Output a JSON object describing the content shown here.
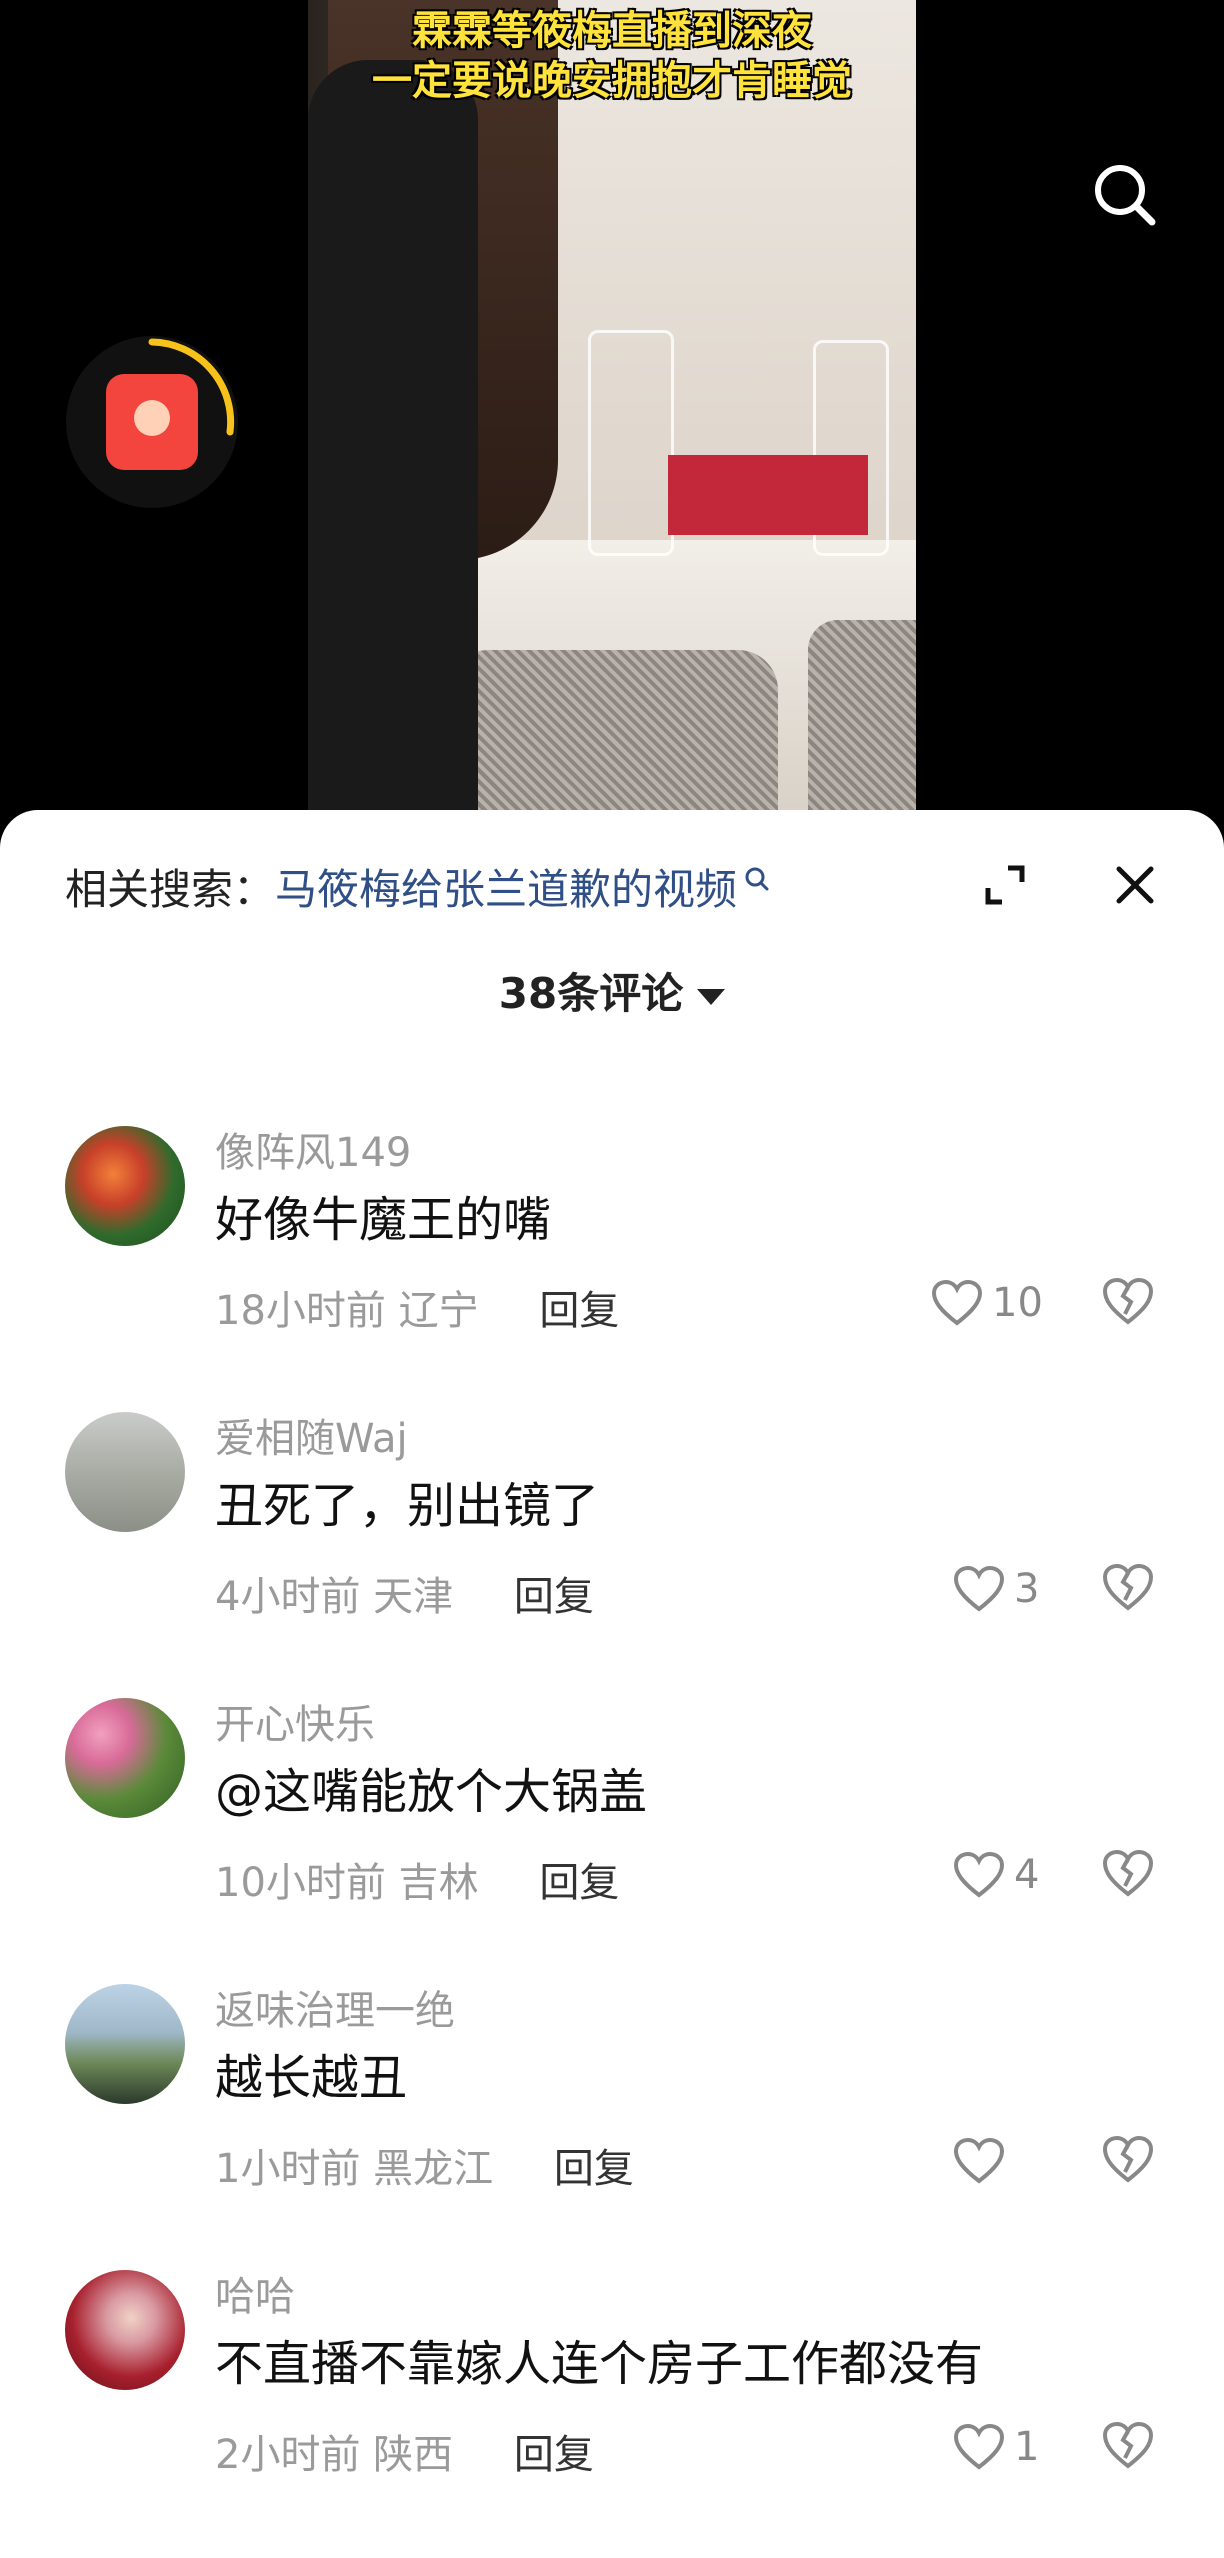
{
  "video": {
    "caption_line1": "霖霖等筱梅直播到深夜",
    "caption_line2": "一定要说晚安拥抱才肯睡觉"
  },
  "icons": {
    "search": "search-icon",
    "red_packet": "red-packet-icon",
    "expand": "expand-icon",
    "close": "close-icon",
    "heart": "heart-icon",
    "dislike": "broken-heart-icon"
  },
  "colors": {
    "accent_query": "#2f4f86",
    "caption_yellow": "#ffe23b",
    "red_packet": "#f3443d",
    "ring": "#f7c21a"
  },
  "sheet": {
    "related_label": "相关搜索：",
    "related_query": "马筱梅给张兰道歉的视频",
    "comment_count_title": "38条评论"
  },
  "comments": [
    {
      "username": "像阵风149",
      "text": "好像牛魔王的嘴",
      "time": "18小时前",
      "location": "辽宁",
      "reply": "回复",
      "likes": "10"
    },
    {
      "username": "爱相随Waj",
      "text": "丑死了，别出镜了",
      "time": "4小时前",
      "location": "天津",
      "reply": "回复",
      "likes": "3"
    },
    {
      "username": "开心快乐",
      "text": "@这嘴能放个大锅盖",
      "time": "10小时前",
      "location": "吉林",
      "reply": "回复",
      "likes": "4"
    },
    {
      "username": "返味治理一绝",
      "text": "越长越丑",
      "time": "1小时前",
      "location": "黑龙江",
      "reply": "回复",
      "likes": ""
    },
    {
      "username": "哈哈",
      "text": "不直播不靠嫁人连个房子工作都没有",
      "time": "2小时前",
      "location": "陕西",
      "reply": "回复",
      "likes": "1"
    }
  ]
}
